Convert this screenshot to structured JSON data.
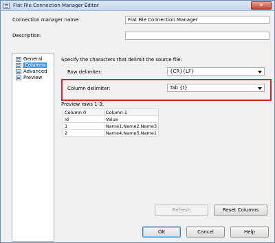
{
  "window": {
    "title": "Flat File Connection Manager Editor",
    "close": "✕"
  },
  "connection": {
    "name_label": "Connection manager name:",
    "name_value": "Flat File Connection Manager",
    "description_label": "Description:",
    "description_value": ""
  },
  "nav": {
    "items": [
      {
        "label": "General",
        "selected": false
      },
      {
        "label": "Columns",
        "selected": true
      },
      {
        "label": "Advanced",
        "selected": false
      },
      {
        "label": "Preview",
        "selected": false
      }
    ]
  },
  "columns_pane": {
    "heading": "Specify the characters that delimit the source file:",
    "row_delimiter_label": "Row delimiter:",
    "row_delimiter_value": "{CR}{LF}",
    "column_delimiter_label": "Column delimiter:",
    "column_delimiter_value": "Tab {t}",
    "preview_label": "Preview rows 1-3:",
    "grid": {
      "headers": [
        "Column 0",
        "Column 1"
      ],
      "rows": [
        [
          "Id",
          "Value"
        ],
        [
          "1",
          "Name1,Name2,Name3"
        ],
        [
          "2",
          "Name4,Name5,Name1"
        ]
      ]
    },
    "refresh_label": "Refresh",
    "reset_label": "Reset Columns"
  },
  "footer": {
    "ok_label": "OK",
    "cancel_label": "Cancel",
    "help_label": "Help"
  },
  "colors": {
    "highlight_border": "#d7202b",
    "selection": "#3399ff"
  }
}
